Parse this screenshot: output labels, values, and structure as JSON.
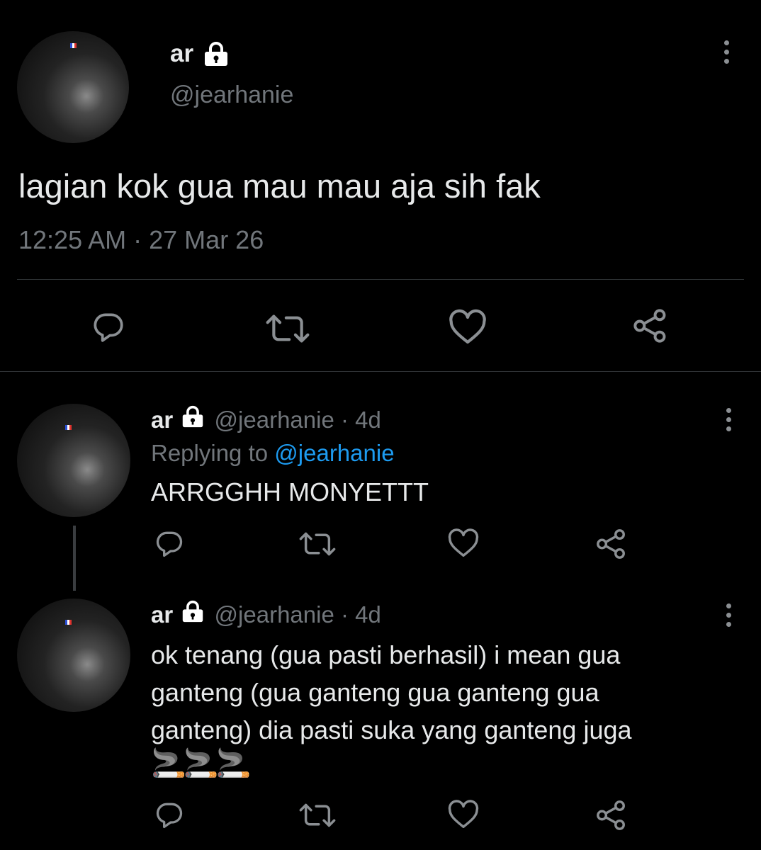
{
  "main_tweet": {
    "display_name": "ar",
    "handle": "@jearhanie",
    "text": "lagian kok gua mau mau aja sih fak",
    "time": "12:25 AM",
    "separator": "·",
    "date": "27 Mar 26"
  },
  "replies": [
    {
      "display_name": "ar",
      "handle": "@jearhanie",
      "age": "· 4d",
      "replying_prefix": "Replying to",
      "replying_handle": "@jearhanie",
      "text": "ARRGGHH MONYETTT"
    },
    {
      "display_name": "ar",
      "handle": "@jearhanie",
      "age": "· 4d",
      "text_lines": [
        "ok tenang (gua pasti berhasil) i mean gua",
        "ganteng (gua ganteng gua ganteng gua",
        "ganteng) dia pasti suka yang ganteng juga"
      ],
      "emoji": "🚬🚬🚬"
    }
  ],
  "icons": [
    "lock-icon",
    "more-icon",
    "reply-icon",
    "retweet-icon",
    "like-icon",
    "share-icon"
  ],
  "colors": {
    "background": "#000000",
    "text": "#e7e9ea",
    "muted": "#71767b",
    "link": "#1d9bf0",
    "icon": "#8b8f93"
  }
}
